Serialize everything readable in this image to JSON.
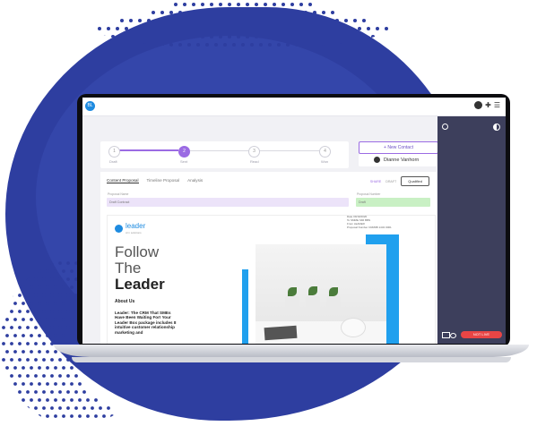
{
  "app": {
    "logo_text": "BL"
  },
  "stepper": {
    "steps": [
      {
        "number": "1",
        "label": "Draft"
      },
      {
        "number": "2",
        "label": "Sent"
      },
      {
        "number": "3",
        "label": "Read"
      },
      {
        "number": "4",
        "label": "Won"
      }
    ],
    "active_step": 2
  },
  "buttons": {
    "new_contact": "+ New Contact",
    "contact_name": "Dianne Vanhorn",
    "qualified": "Qualified",
    "share": "SHARE",
    "draft": "DRAFT"
  },
  "tabs": [
    "Content Proposal",
    "Timeline Proposal",
    "Analysis"
  ],
  "fields": {
    "proposal_name_label": "Proposal Name",
    "proposal_name_value": "Draft Contract",
    "proposal_number_label": "Proposal Number",
    "proposal_number_value": "Draft"
  },
  "document": {
    "brand": "leader",
    "brand_sub": "crm solutions",
    "heading_1": "Follow",
    "heading_2": "The",
    "heading_3": "Leader",
    "about_title": "About Us",
    "body": "Leader: The CRM That SMEs Have Been Waiting For! Your Leader Box package includes 8 intuitive customer relationship marketing and",
    "meta": [
      "Date   09/19/2020",
      "To   SMME SMI BBN",
      "From   LEADER",
      "Proposal Number   CRM0B 1434 0001"
    ]
  },
  "right_panel": {
    "status_text": "NOT LIVE"
  },
  "colors": {
    "accent": "#9b6be3",
    "brand_blue": "#1e8be0",
    "panel": "#3d3f5c",
    "alert": "#e84545",
    "blob": "#2e3ea0"
  }
}
